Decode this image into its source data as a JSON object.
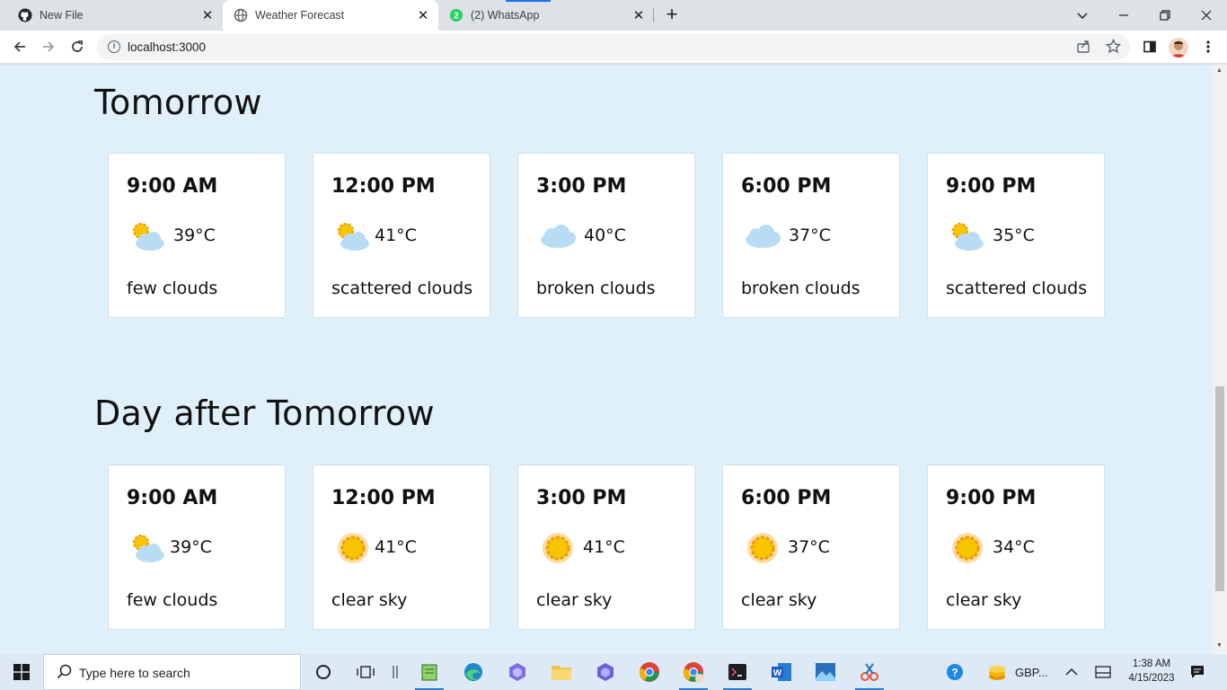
{
  "browser": {
    "tabs": [
      {
        "title": "New File",
        "icon": "github-icon"
      },
      {
        "title": "Weather Forecast",
        "icon": "globe-icon",
        "active": true
      },
      {
        "title": "(2) WhatsApp",
        "icon": "whatsapp-icon",
        "badge": "2"
      }
    ],
    "url": "localhost:3000"
  },
  "page": {
    "sections": [
      {
        "title": "Tomorrow",
        "forecasts": [
          {
            "time": "9:00 AM",
            "temp": "39°C",
            "desc": "few clouds",
            "icon": "few-clouds-icon"
          },
          {
            "time": "12:00 PM",
            "temp": "41°C",
            "desc": "scattered clouds",
            "icon": "few-clouds-icon"
          },
          {
            "time": "3:00 PM",
            "temp": "40°C",
            "desc": "broken clouds",
            "icon": "cloud-icon"
          },
          {
            "time": "6:00 PM",
            "temp": "37°C",
            "desc": "broken clouds",
            "icon": "cloud-icon"
          },
          {
            "time": "9:00 PM",
            "temp": "35°C",
            "desc": "scattered clouds",
            "icon": "few-clouds-icon"
          }
        ]
      },
      {
        "title": "Day after Tomorrow",
        "forecasts": [
          {
            "time": "9:00 AM",
            "temp": "39°C",
            "desc": "few clouds",
            "icon": "few-clouds-icon"
          },
          {
            "time": "12:00 PM",
            "temp": "41°C",
            "desc": "clear sky",
            "icon": "sun-icon"
          },
          {
            "time": "3:00 PM",
            "temp": "41°C",
            "desc": "clear sky",
            "icon": "sun-icon"
          },
          {
            "time": "6:00 PM",
            "temp": "37°C",
            "desc": "clear sky",
            "icon": "sun-icon"
          },
          {
            "time": "9:00 PM",
            "temp": "34°C",
            "desc": "clear sky",
            "icon": "sun-icon"
          }
        ]
      }
    ]
  },
  "taskbar": {
    "search_placeholder": "Type here to search",
    "tray_currency": "GBP...",
    "time": "1:38 AM",
    "date": "4/15/2023"
  },
  "colors": {
    "page_bg": "#dff0fb",
    "card_bg": "#ffffff",
    "sun": "#f7c600",
    "cloud": "#b9dcf5"
  }
}
